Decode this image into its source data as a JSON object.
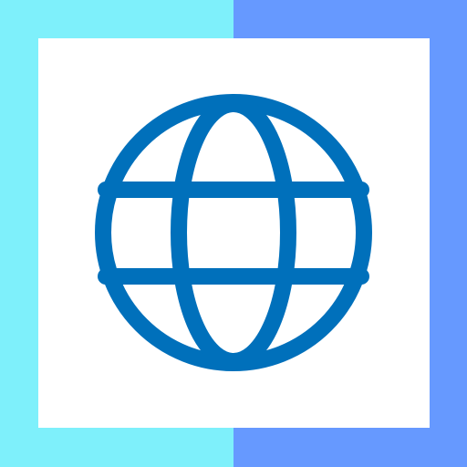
{
  "colors": {
    "background_left": "#7EF0FB",
    "background_right": "#6699FF",
    "card": "#FFFFFF",
    "globe_stroke": "#0070BB"
  },
  "icon": {
    "name": "globe-icon"
  }
}
